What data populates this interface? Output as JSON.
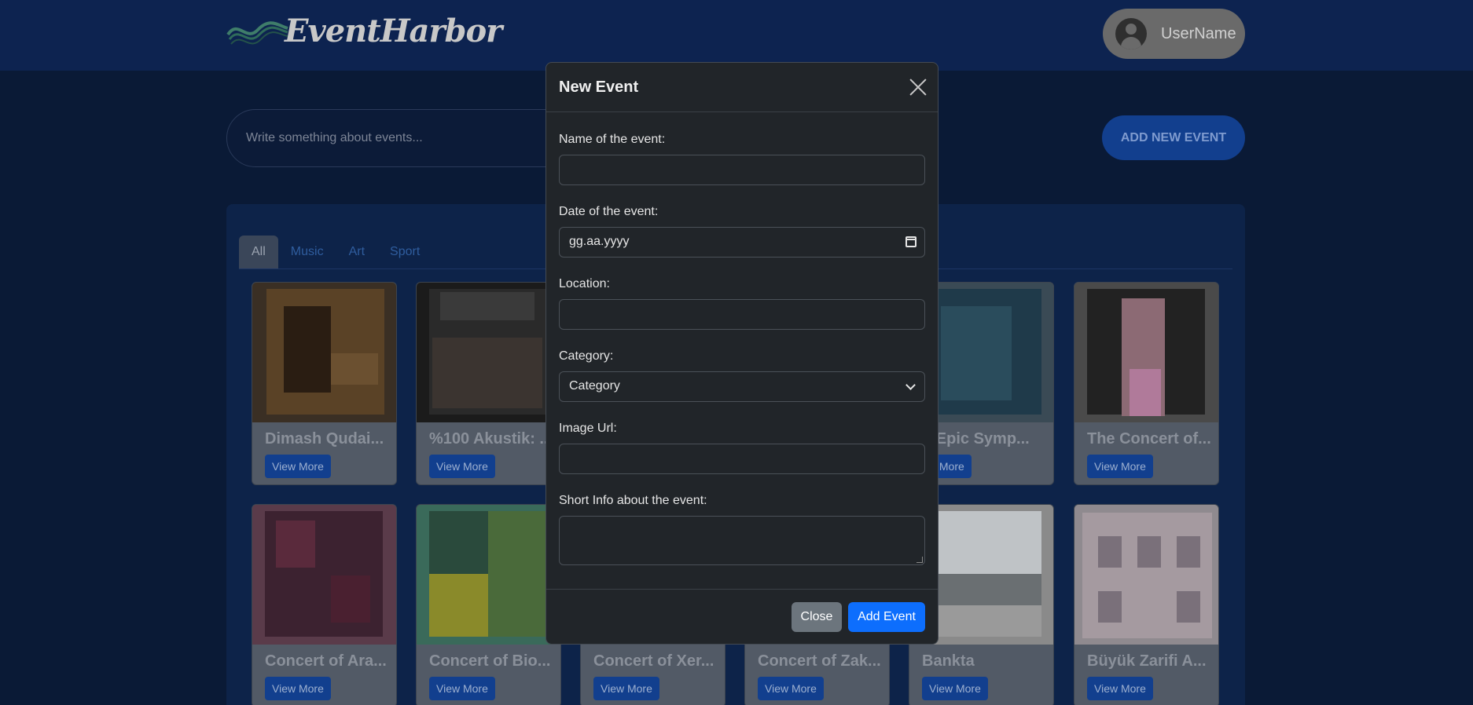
{
  "header": {
    "brand": "EventHarbor",
    "username": "UserName"
  },
  "search": {
    "placeholder": "Write something about events..."
  },
  "add_new_label": "ADD NEW EVENT",
  "tabs": [
    {
      "label": "All"
    },
    {
      "label": "Music"
    },
    {
      "label": "Art"
    },
    {
      "label": "Sport"
    }
  ],
  "cards": [
    {
      "title": "Dimash Qudai...",
      "button": "View More"
    },
    {
      "title": "%100 Akustik: ...",
      "button": "View More"
    },
    {
      "title": "",
      "button": ""
    },
    {
      "title": "",
      "button": ""
    },
    {
      "title": "n Epic Symp...",
      "button": "iew More"
    },
    {
      "title": "The Concert of...",
      "button": "View More"
    },
    {
      "title": "Concert of Ara...",
      "button": "View More"
    },
    {
      "title": "Concert of Bio...",
      "button": "View More"
    },
    {
      "title": "Concert of Xer...",
      "button": "View More"
    },
    {
      "title": "Concert of Zak...",
      "button": "View More"
    },
    {
      "title": "Bankta",
      "button": "View More"
    },
    {
      "title": "Büyük Zarifi A...",
      "button": "View More"
    }
  ],
  "modal": {
    "title": "New Event",
    "name_label": "Name of the event:",
    "date_label": "Date of the event:",
    "date_value": "gg.aa.yyyy",
    "location_label": "Location:",
    "category_label": "Category:",
    "category_value": "Category",
    "image_label": "Image Url:",
    "info_label": "Short Info about the event:",
    "close_label": "Close",
    "add_label": "Add Event"
  },
  "colors": {
    "page_bg": "#0a1a36",
    "header_bg": "#0d2350",
    "modal_bg": "#212529",
    "primary": "#0d6efd",
    "secondary": "#6c757d"
  }
}
